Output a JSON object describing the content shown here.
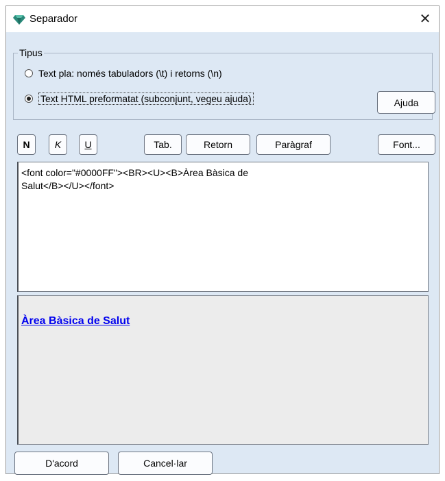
{
  "window": {
    "title": "Separador",
    "icon": "gem-icon",
    "close_glyph": "✕"
  },
  "tipus": {
    "legend": "Tipus",
    "options": [
      {
        "label": "Text pla: només tabuladors (\\t) i retorns (\\n)",
        "checked": false
      },
      {
        "label": "Text HTML preformatat (subconjunt, vegeu ajuda)",
        "checked": true
      }
    ],
    "help_button": "Ajuda"
  },
  "toolbar": {
    "bold": "N",
    "italic": "K",
    "underline": "U",
    "tab": "Tab.",
    "retorn": "Retorn",
    "paragraf": "Paràgraf",
    "font": "Font..."
  },
  "editor": {
    "line1": "<font color=\"#0000FF\"><BR><U><B>Àrea Bàsica de",
    "line2": "Salut</B></U></font>"
  },
  "preview": {
    "text": "Àrea Bàsica de Salut",
    "color": "#0000FF"
  },
  "footer": {
    "ok": "D'acord",
    "cancel": "Cancel·lar"
  },
  "colors": {
    "dialog_bg": "#dde8f4",
    "title_bg": "#ffffff",
    "preview_bg": "#ececec",
    "icon": "#2a8a7a"
  }
}
